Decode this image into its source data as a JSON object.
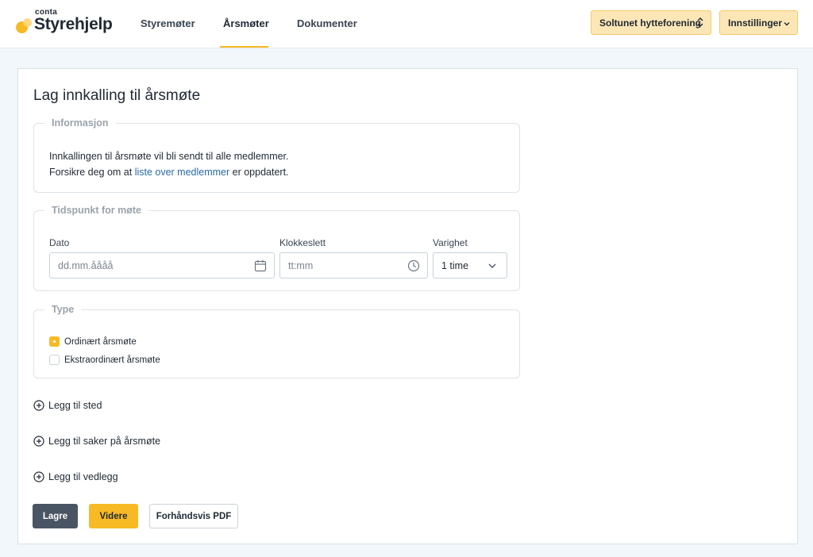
{
  "header": {
    "logo_brand": "conta",
    "logo_name": "Styrehjelp",
    "nav": [
      {
        "label": "Styremøter"
      },
      {
        "label": "Årsmøter"
      },
      {
        "label": "Dokumenter"
      }
    ],
    "active_nav": "Årsmøter",
    "org_select": "Soltunet hytteforening",
    "settings": "Innstillinger"
  },
  "page": {
    "title": "Lag innkalling til årsmøte"
  },
  "info": {
    "legend": "Informasjon",
    "line1": "Innkallingen til årsmøte vil bli sendt til alle medlemmer.",
    "line2_prefix": "Forsikre deg om at ",
    "line2_link": "liste over medlemmer",
    "line2_suffix": " er oppdatert."
  },
  "time": {
    "legend": "Tidspunkt for møte",
    "date_label": "Dato",
    "date_placeholder": "dd.mm.åååå",
    "time_label": "Klokkeslett",
    "time_placeholder": "tt:mm",
    "duration_label": "Varighet",
    "duration_value": "1 time"
  },
  "type": {
    "legend": "Type",
    "options": [
      {
        "label": "Ordinært årsmøte",
        "selected": true
      },
      {
        "label": "Ekstraordinært årsmøte",
        "selected": false
      }
    ]
  },
  "add_links": {
    "place": "Legg til sted",
    "cases": "Legg til saker på årsmøte",
    "attachments": "Legg til vedlegg"
  },
  "actions": {
    "save": "Lagre",
    "next": "Videre",
    "preview_pdf": "Forhåndsvis PDF"
  },
  "colors": {
    "accent": "#f7b924",
    "accent_light": "#fde6b6",
    "dark_button": "#4a5563",
    "link": "#2a6aa3",
    "background": "#f1f7fa"
  },
  "icons": {
    "calendar": "calendar-icon",
    "clock": "clock-icon",
    "chevron": "chevron-down-icon",
    "updown": "updown-chevron-icon",
    "plus_circle": "plus-circle-icon"
  }
}
